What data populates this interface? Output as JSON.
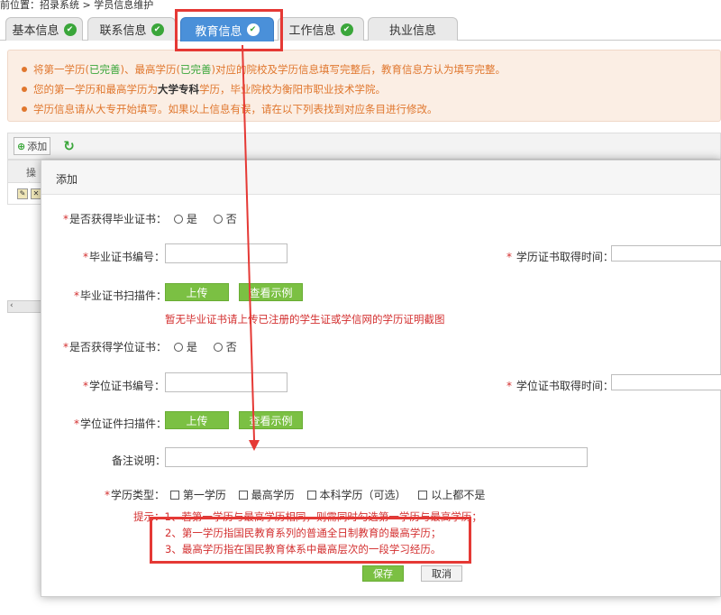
{
  "breadcrumb": {
    "text": "前位置：招录系统 > 学员信息维护"
  },
  "tabs": [
    {
      "label": "基本信息",
      "done": true
    },
    {
      "label": "联系信息",
      "done": true
    },
    {
      "label": "教育信息",
      "done": true,
      "active": true
    },
    {
      "label": "工作信息",
      "done": true
    },
    {
      "label": "执业信息",
      "done": false
    }
  ],
  "notice": {
    "line1_a": "将第一学历(",
    "line1_b": "已完善",
    "line1_c": ")、最高学历(",
    "line1_d": "已完善",
    "line1_e": ")对应的院校及学历信息填写完整后，教育信息方认为填写完整。",
    "line2_a": "您的第一学历和最高学历为",
    "line2_b": "大学专科",
    "line2_c": "学历，毕业院校为衡阳市职业技术学院。",
    "line3": "学历信息请从大专开始填写。如果以上信息有误，请在以下列表找到对应条目进行修改。"
  },
  "toolbar": {
    "add_label": "添加"
  },
  "grid": {
    "col_action": "操作"
  },
  "modal": {
    "title": "添加",
    "has_grad_cert_label": "是否获得毕业证书：",
    "yes": "是",
    "no": "否",
    "grad_cert_no_label": "毕业证书编号：",
    "edu_cert_time_label": "学历证书取得时间：",
    "grad_scan_label": "毕业证书扫描件：",
    "upload": "上传",
    "view_sample": "查看示例",
    "no_cert_hint": "暂无毕业证书请上传已注册的学生证或学信网的学历证明截图",
    "has_degree_label": "是否获得学位证书：",
    "degree_no_label": "学位证书编号：",
    "degree_time_label": "学位证书取得时间：",
    "degree_scan_label": "学位证件扫描件：",
    "remark_label": "备注说明：",
    "edu_type_label": "学历类型：",
    "type_first": "第一学历",
    "type_highest": "最高学历",
    "type_bachelor": "本科学历（可选）",
    "type_none": "以上都不是",
    "tip1": "提示：1、若第一学历与最高学历相同，则需同时勾选第一学历与最高学历；",
    "tip2": "2、第一学历指国民教育系列的普通全日制教育的最高学历；",
    "tip3": "3、最高学历指在国民教育体系中最高层次的一段学习经历。",
    "save": "保存",
    "cancel": "取消"
  },
  "colors": {
    "accent_blue": "#4a90d9",
    "success_green": "#3aa63a",
    "button_green": "#7bc043",
    "warning_orange": "#e0772e",
    "annotation_red": "#e53935"
  }
}
